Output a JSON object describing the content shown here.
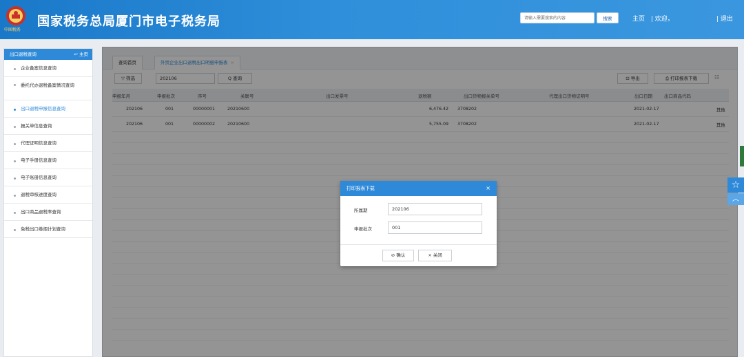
{
  "header": {
    "title": "国家税务总局厦门市电子税务局",
    "emblem_caption": "中国税务",
    "search_placeholder": "请输入需要搜索的内容",
    "search_button": "搜索",
    "home_link": "主页",
    "welcome_link": "| 欢迎，",
    "logout_link": "| 退出"
  },
  "sidebar": {
    "title": "出口退税查询",
    "home": "↩ 主页",
    "items": [
      {
        "label": "企业备案信息查询"
      },
      {
        "label": "委托代办退税备案情况查询"
      },
      {
        "label": "出口退税申报信息查询"
      },
      {
        "label": "报关单信息查询"
      },
      {
        "label": "代理证明信息查询"
      },
      {
        "label": "电子手册信息查询"
      },
      {
        "label": "电子账册信息查询"
      },
      {
        "label": "退税审核进度查询"
      },
      {
        "label": "出口商品退税率查询"
      },
      {
        "label": "免税出口卷烟计划查询"
      }
    ]
  },
  "tabs": [
    {
      "label": "查询首页"
    },
    {
      "label": "外贸企业出口退税出口明细申报表",
      "close": "×"
    }
  ],
  "toolbar": {
    "filter": "▽ 筛选",
    "period_value": "202106",
    "query": "Q 查询",
    "export": "⊡ 导出",
    "print": "⎙ 打印报表下载",
    "columns_icon": "☷"
  },
  "table": {
    "columns": [
      "申报年月",
      "申报批次",
      "序号",
      "关联号",
      "出口发票号",
      "退税额",
      "出口货物报关单号",
      "代理出口货物证明号",
      "出口日期",
      "出口商品代码"
    ],
    "rows": [
      {
        "period": "202106",
        "batch": "001",
        "seq": "00000001",
        "link": "20210600",
        "tax": "6,476.42",
        "customs": "3708202",
        "date": "2021-02-17",
        "extra": "其他"
      },
      {
        "period": "202106",
        "batch": "001",
        "seq": "00000002",
        "link": "20210600",
        "tax": "5,755.09",
        "customs": "3708202",
        "date": "2021-02-17",
        "extra": "其他"
      }
    ]
  },
  "modal": {
    "title": "打印报表下载",
    "close": "×",
    "field1_label": "所属期",
    "field1_value": "202106",
    "field2_label": "申报批次",
    "field2_value": "001",
    "confirm": "⊘ 确认",
    "cancel": "× 关闭"
  },
  "floating": {
    "star": "☆",
    "up": "︿"
  }
}
